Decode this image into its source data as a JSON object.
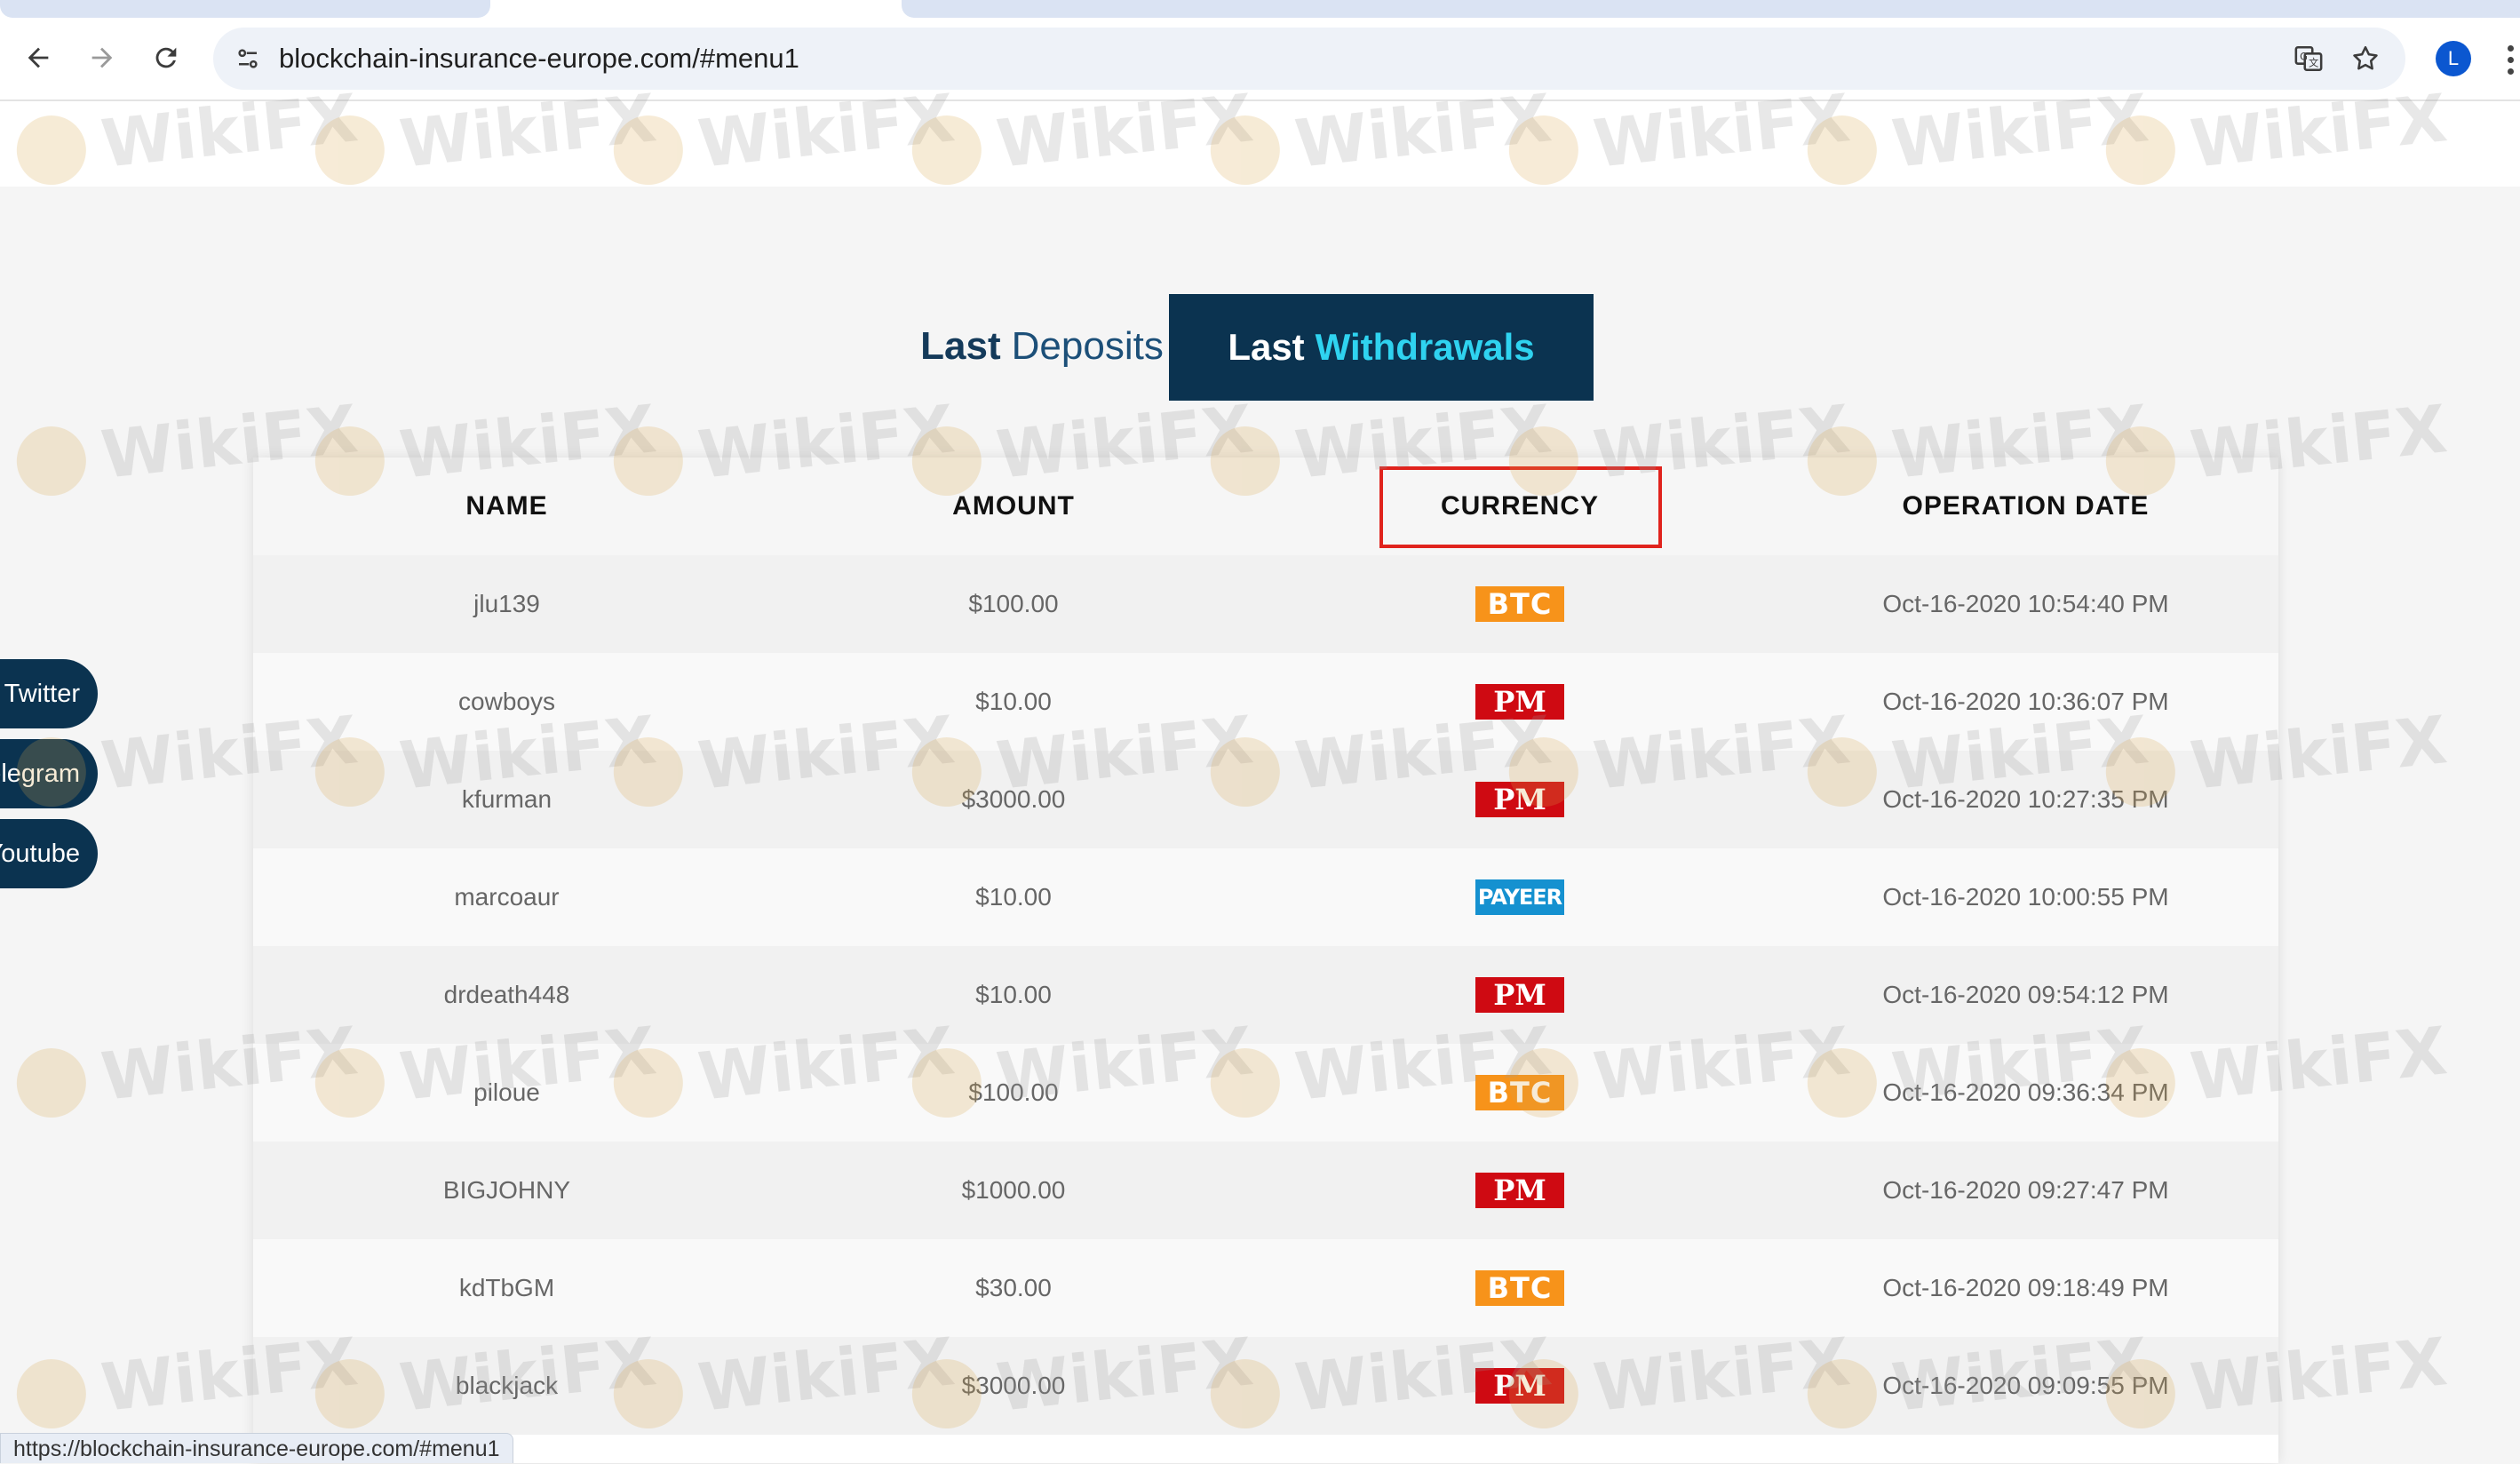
{
  "browser": {
    "url": "blockchain-insurance-europe.com/#menu1",
    "avatar_letter": "L",
    "status_url": "https://blockchain-insurance-europe.com/#menu1",
    "icons": [
      "back-arrow-icon",
      "forward-arrow-icon",
      "reload-icon",
      "site-info-icon",
      "translate-icon",
      "bookmark-star-icon",
      "menu-icon"
    ]
  },
  "tabs": {
    "deposits": {
      "bold": "Last",
      "rest": "Deposits"
    },
    "withdrawals": {
      "bold": "Last",
      "rest": "Withdrawals"
    },
    "active": "withdrawals"
  },
  "table": {
    "headers": [
      "NAME",
      "AMOUNT",
      "CURRENCY",
      "OPERATION DATE"
    ],
    "highlighted_header": "CURRENCY",
    "rows": [
      {
        "name": "jlu139",
        "amount": "$100.00",
        "currency": "BTC",
        "date": "Oct-16-2020 10:54:40 PM"
      },
      {
        "name": "cowboys",
        "amount": "$10.00",
        "currency": "PM",
        "date": "Oct-16-2020 10:36:07 PM"
      },
      {
        "name": "kfurman",
        "amount": "$3000.00",
        "currency": "PM",
        "date": "Oct-16-2020 10:27:35 PM"
      },
      {
        "name": "marcoaur",
        "amount": "$10.00",
        "currency": "PAYEER",
        "date": "Oct-16-2020 10:00:55 PM"
      },
      {
        "name": "drdeath448",
        "amount": "$10.00",
        "currency": "PM",
        "date": "Oct-16-2020 09:54:12 PM"
      },
      {
        "name": "piloue",
        "amount": "$100.00",
        "currency": "BTC",
        "date": "Oct-16-2020 09:36:34 PM"
      },
      {
        "name": "BIGJOHNY",
        "amount": "$1000.00",
        "currency": "PM",
        "date": "Oct-16-2020 09:27:47 PM"
      },
      {
        "name": "kdTbGM",
        "amount": "$30.00",
        "currency": "BTC",
        "date": "Oct-16-2020 09:18:49 PM"
      },
      {
        "name": "blackjack",
        "amount": "$3000.00",
        "currency": "PM",
        "date": "Oct-16-2020 09:09:55 PM"
      }
    ]
  },
  "social": [
    {
      "label": "Twitter"
    },
    {
      "label": "Telegram"
    },
    {
      "label": "Youtube"
    }
  ],
  "watermark": {
    "text": "WikiFX"
  },
  "colors": {
    "accent_dark": "#0b3350",
    "accent_cyan": "#2fd3f0",
    "btc": "#f7931a",
    "pm": "#cf0a12",
    "payeer": "#1591d0",
    "highlight_box": "#e0231d"
  }
}
